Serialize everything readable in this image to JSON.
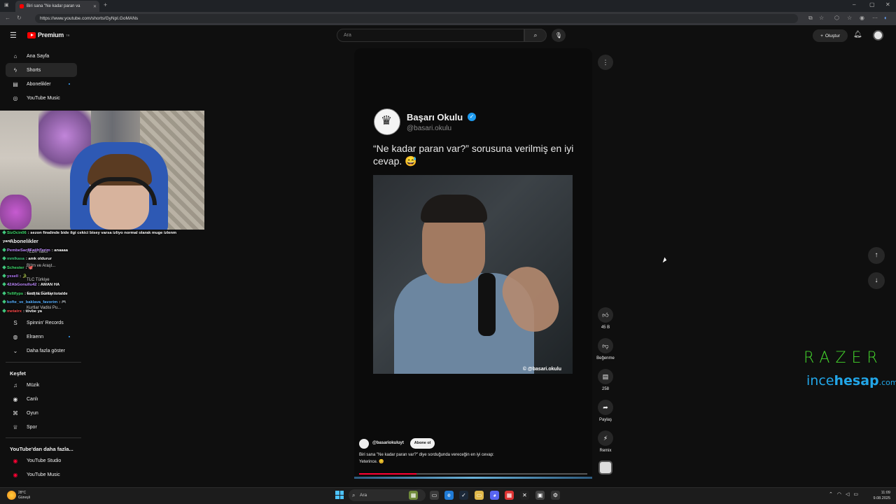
{
  "browser": {
    "tab_title": "Biri sana \"Ne kadar paran va",
    "url": "https://www.youtube.com/shorts/GyNpI.GoMANs",
    "new_tab": "+"
  },
  "header": {
    "brand": "Premium",
    "brand_sup": "TR",
    "search_placeholder": "Ara",
    "create_label": "Oluştur"
  },
  "sidebar": {
    "main_items": [
      {
        "label": "Ana Sayfa",
        "icon": "home-icon"
      },
      {
        "label": "Shorts",
        "icon": "shorts-icon",
        "active": true
      },
      {
        "label": "Abonelikler",
        "icon": "subscriptions-icon"
      },
      {
        "label": "YouTube Music",
        "icon": "music-icon"
      }
    ],
    "subs_heading": "Abonelikler",
    "subscriptions": [
      {
        "label": "TEDx Talks"
      },
      {
        "label": "Bilim ve Araşt..."
      },
      {
        "label": "TLC Türkiye"
      },
      {
        "label": "Gerçek Türkiye"
      },
      {
        "label": "Kurtlar Vadisi Pu..."
      },
      {
        "label": "Spinnin' Records"
      },
      {
        "label": "Elraenn"
      }
    ],
    "show_more": "Daha fazla göster",
    "explore_heading": "Keşfet",
    "explore_items": [
      {
        "label": "Müzik",
        "icon": "music-note-icon"
      },
      {
        "label": "Canlı",
        "icon": "live-icon"
      },
      {
        "label": "Oyun",
        "icon": "gaming-icon"
      },
      {
        "label": "Spor",
        "icon": "trophy-icon"
      }
    ],
    "more_heading": "YouTube'dan daha fazla...",
    "more_items": [
      {
        "label": "YouTube Studio"
      },
      {
        "label": "YouTube Music"
      }
    ]
  },
  "chat": [
    {
      "user": "SizOcin06",
      "color": "#41e06f",
      "msg": ": sezon finalinde bide ilgi cekici bisey varsa izliyo normal olarak muge izlenm"
    },
    {
      "user": "",
      "color": "#ffffff",
      "msg": "yani"
    },
    {
      "user": "PembeSac8FatihTerim",
      "color": "#c08cff",
      "msg": ": anaaaa"
    },
    {
      "user": "mmlkasa",
      "color": "#41c77d",
      "msg": ": amk oldurur"
    },
    {
      "user": "Schester",
      "color": "#41e06f",
      "msg": ": 🐙"
    },
    {
      "user": "yxsell",
      "color": "#b87cff",
      "msg": ": 🐊"
    },
    {
      "user": "42AbGonullu42",
      "color": "#c08cff",
      "msg": ": AMAN HA"
    },
    {
      "user": "Tellifyps",
      "color": "#41e06f",
      "msg": ": kedi la bunlar totalde"
    },
    {
      "user": "kofte_ve_baklava_favorim",
      "color": "#58b0ff",
      "msg": ": 🎮"
    },
    {
      "user": "metatrx",
      "color": "#ff4b4b",
      "msg": ": tövbe ya"
    }
  ],
  "post": {
    "name": "Başarı Okulu",
    "handle": "@basari.okulu",
    "text": "“Ne kadar paran var?” sorusuna verilmiş en iyi cevap. 😅",
    "watermark": "© @basari.okulu"
  },
  "short": {
    "channel": "@basariokuluyt",
    "subscribe": "Abone ol",
    "description_line1": "Biri sana \"Ne kadar paran var?\" diye sorduğunda vereceğin en iyi cevap:",
    "description_line2": "Yeterince. 😊",
    "progress": 0.25
  },
  "actions": {
    "like_count": "45 B",
    "dislike_label": "Beğenme",
    "comment_count": "258",
    "share_label": "Paylaş",
    "remix_label": "Remix"
  },
  "sponsor": {
    "razer": "RAZER",
    "ince_a": "ince",
    "ince_b": "hesap",
    "ince_c": ".com"
  },
  "taskbar": {
    "temp": "28°C",
    "weather": "Güneşli",
    "search": "Ara",
    "time": "11:09",
    "date": "9.08.2025"
  },
  "colors": {
    "accent_red": "#ff0000",
    "razer_green": "#44d62c",
    "ince_blue": "#22a6e8"
  }
}
